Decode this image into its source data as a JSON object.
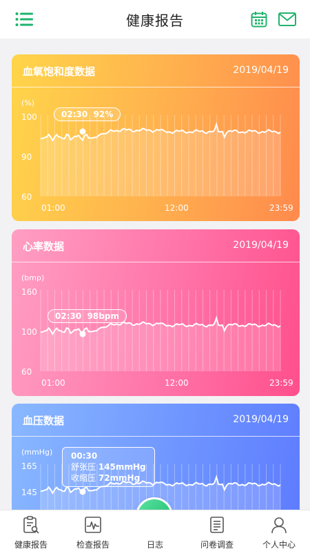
{
  "header": {
    "title": "健康报告"
  },
  "cards": [
    {
      "title": "血氧饱和度数据",
      "date": "2019/04/19",
      "unit": "(%)",
      "y_labels": [
        "100",
        "90",
        "60"
      ],
      "x_labels": [
        "01:00",
        "12:00",
        "23:59"
      ],
      "tooltip": {
        "time": "02:30",
        "value": "92%"
      }
    },
    {
      "title": "心率数据",
      "date": "2019/04/19",
      "unit": "(bmp)",
      "y_labels": [
        "160",
        "100",
        "60"
      ],
      "x_labels": [
        "01:00",
        "12:00",
        "23:59"
      ],
      "tooltip": {
        "time": "02:30",
        "value": "98bpm"
      }
    },
    {
      "title": "血压数据",
      "date": "2019/04/19",
      "unit": "(mmHg)",
      "y_labels": [
        "165",
        "145"
      ],
      "tooltip": {
        "time": "00:30",
        "line1_label": "舒张压",
        "line1_value": "145mmHg",
        "line2_label": "收缩压",
        "line2_value": "72mmHg"
      }
    }
  ],
  "tabbar": {
    "items": [
      {
        "label": "健康报告",
        "icon": "report-clipboard-icon"
      },
      {
        "label": "检查报告",
        "icon": "pulse-chart-icon"
      },
      {
        "label": "日志",
        "icon": "pencil-icon"
      },
      {
        "label": "问卷调查",
        "icon": "questionnaire-list-icon"
      },
      {
        "label": "个人中心",
        "icon": "user-icon"
      }
    ]
  },
  "colors": {
    "accent": "#1fb36b",
    "spo2_gradient": [
      "#ffd54a",
      "#ff8a4d"
    ],
    "heart_gradient": [
      "#ff9ec2",
      "#ff4f8c"
    ],
    "bp_gradient": [
      "#8ab8ff",
      "#5e7cff"
    ]
  }
}
